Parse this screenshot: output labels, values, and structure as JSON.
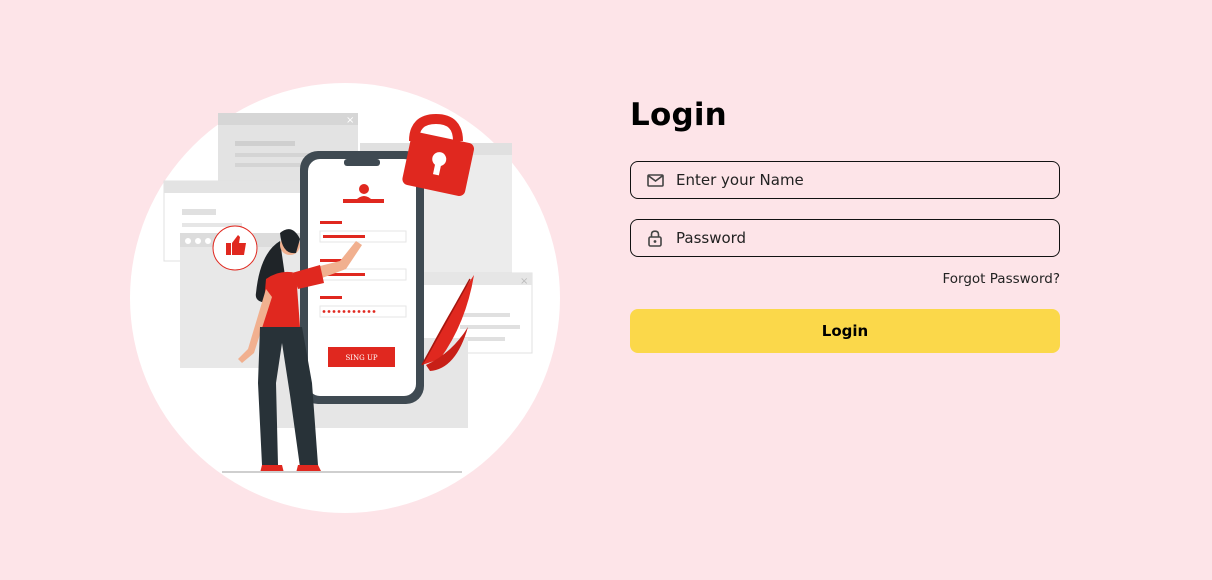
{
  "login_form": {
    "title": "Login",
    "name_field": {
      "placeholder": "Enter your Name",
      "icon": "mail-icon"
    },
    "password_field": {
      "placeholder": "Password",
      "icon": "lock-icon"
    },
    "forgot_password": "Forgot Password?",
    "submit_label": "Login"
  },
  "illustration": {
    "signup_button_text": "SING UP"
  },
  "colors": {
    "background": "#fde4e8",
    "accent_red": "#e0281f",
    "button_yellow": "#fbd84a"
  }
}
